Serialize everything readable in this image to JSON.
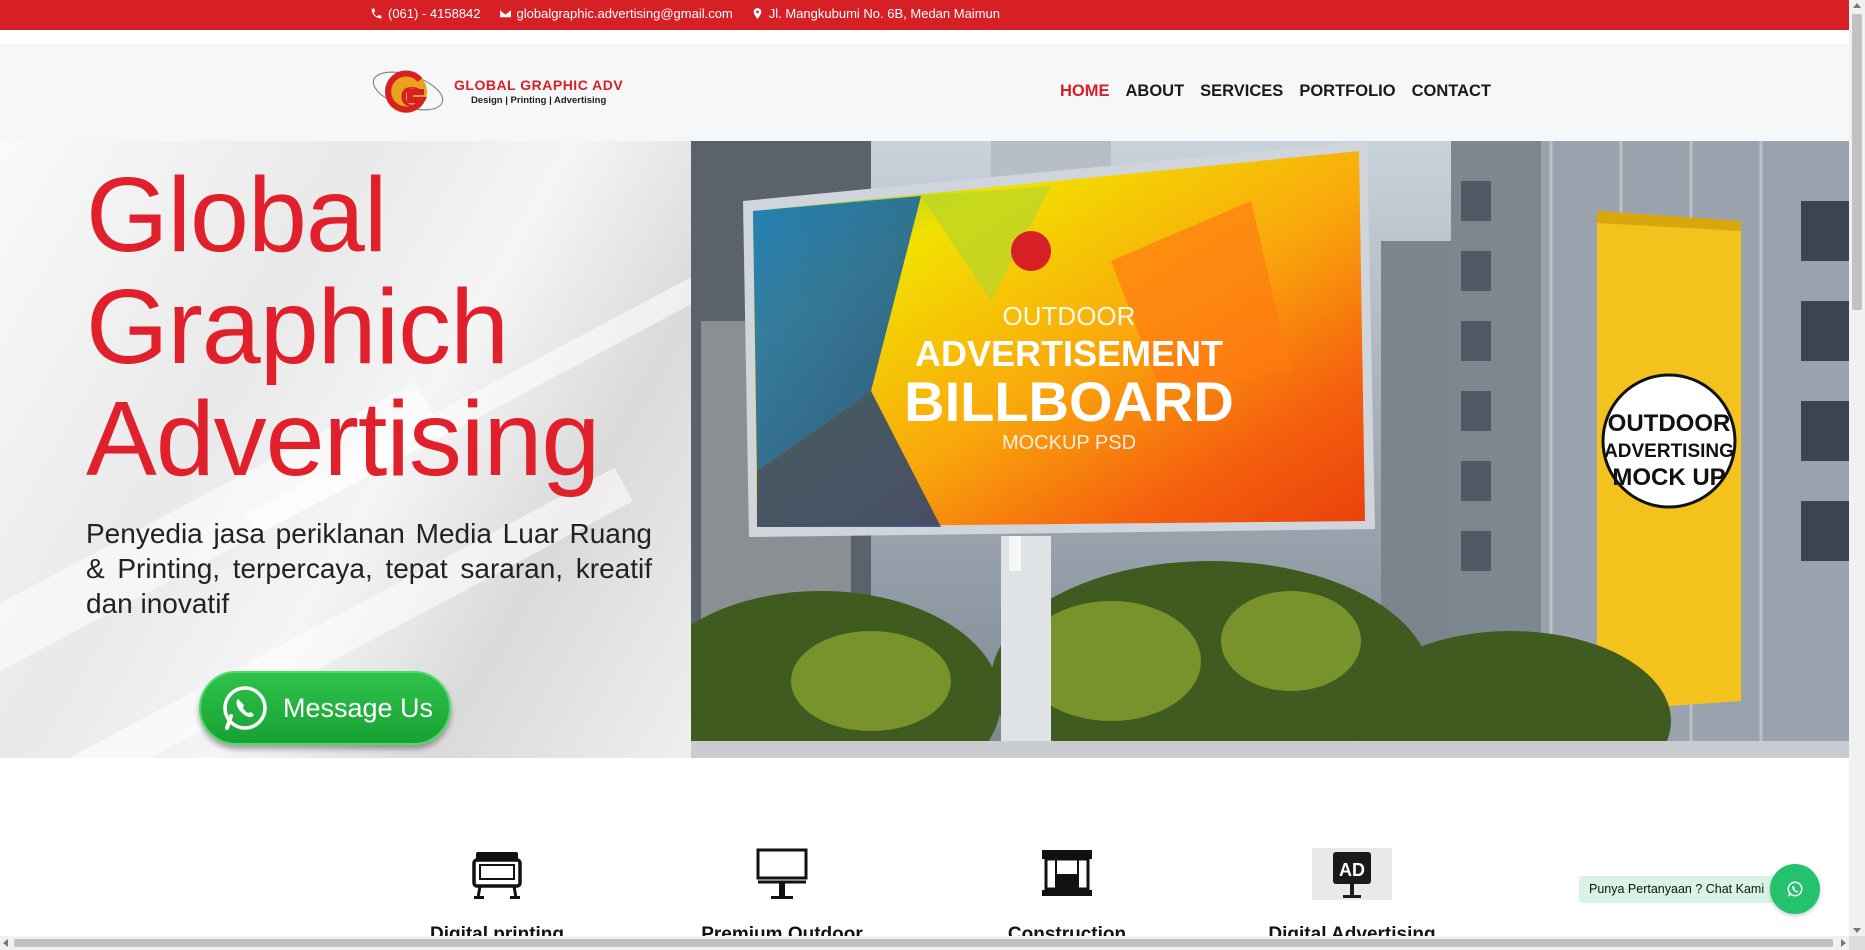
{
  "topbar": {
    "phone": "(061) - 4158842",
    "email": "globalgraphic.advertising@gmail.com",
    "address": "Jl. Mangkubumi No. 6B, Medan Maimun"
  },
  "header": {
    "logo_name": "GLOBAL GRAPHIC ADV",
    "logo_tagline": "Design | Printing | Advertising",
    "nav": [
      "HOME",
      "ABOUT",
      "SERVICES",
      "PORTFOLIO",
      "CONTACT"
    ],
    "active_nav": "HOME"
  },
  "hero": {
    "title_line1": "Global",
    "title_line2": "Graphich",
    "title_line3": "Advertising",
    "description": "Penyedia jasa periklanan Media Luar Ruang & Printing, terpercaya, tepat sararan, kreatif dan inovatif",
    "cta_label": "Message Us",
    "billboard_small": "OUTDOOR",
    "billboard_line1": "ADVERTISEMENT",
    "billboard_line2": "BILLBOARD",
    "billboard_line3": "MOCKUP PSD",
    "banner_line1": "OUTDOOR",
    "banner_line2": "ADVERTISING",
    "banner_line3": "MOCK UP"
  },
  "services": [
    {
      "label": "Digital printing",
      "icon": "printer-icon"
    },
    {
      "label": "Premium Outdoor",
      "icon": "billboard-icon"
    },
    {
      "label": "Construction",
      "icon": "construction-icon"
    },
    {
      "label": "Digital Advertising",
      "icon": "ad-sign-icon",
      "icon_text": "AD"
    }
  ],
  "chat": {
    "label": "Punya Pertanyaan ? Chat Kami"
  },
  "colors": {
    "brand_red": "#d71f26",
    "whatsapp_green": "#25c26e"
  }
}
